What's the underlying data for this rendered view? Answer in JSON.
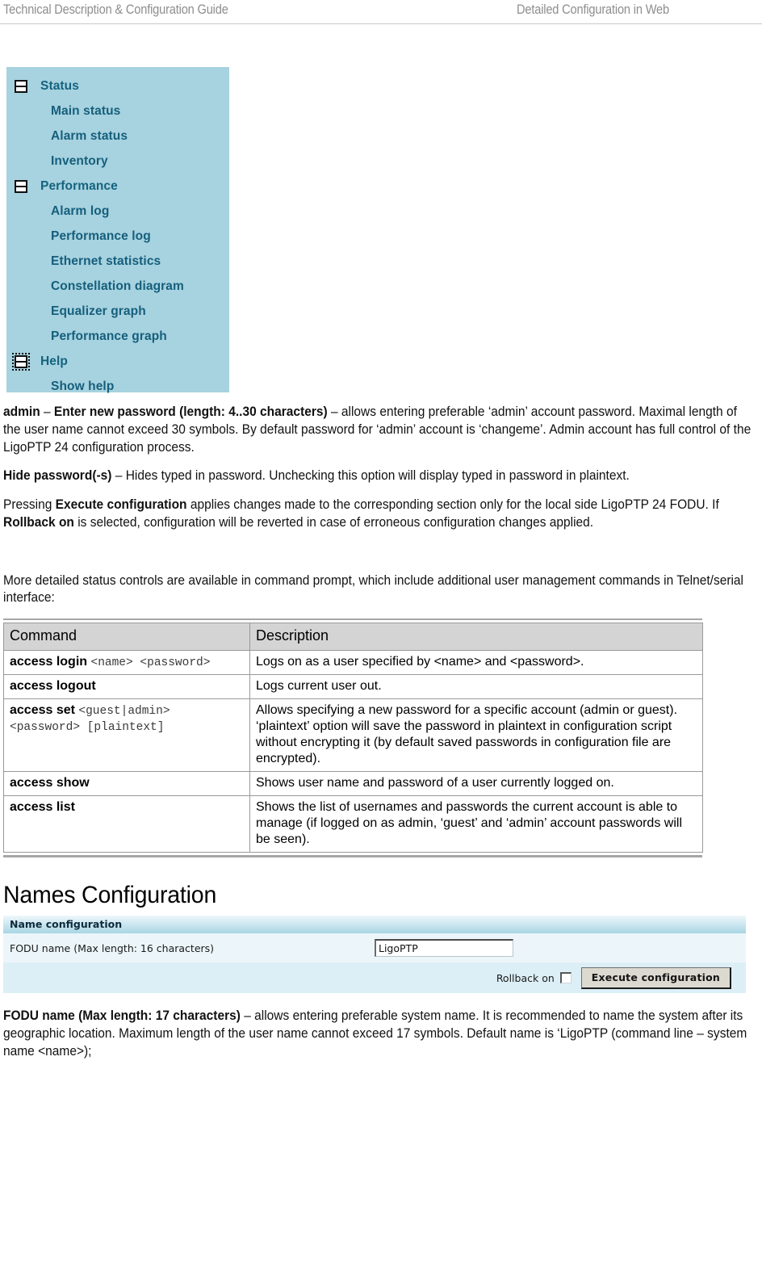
{
  "header": {
    "left": "Technical Description & Configuration Guide",
    "right": "Detailed Configuration in Web"
  },
  "tree": {
    "icon_collapse": "minus-box-icon",
    "items": [
      {
        "label": "Status",
        "level": 0,
        "icon": true,
        "focused": false
      },
      {
        "label": "Main status",
        "level": 1,
        "icon": false,
        "focused": false
      },
      {
        "label": "Alarm status",
        "level": 1,
        "icon": false,
        "focused": false
      },
      {
        "label": "Inventory",
        "level": 1,
        "icon": false,
        "focused": false
      },
      {
        "label": "Performance",
        "level": 0,
        "icon": true,
        "focused": false
      },
      {
        "label": "Alarm log",
        "level": 1,
        "icon": false,
        "focused": false
      },
      {
        "label": "Performance log",
        "level": 1,
        "icon": false,
        "focused": false
      },
      {
        "label": "Ethernet statistics",
        "level": 1,
        "icon": false,
        "focused": false
      },
      {
        "label": "Constellation diagram",
        "level": 1,
        "icon": false,
        "focused": false
      },
      {
        "label": "Equalizer graph",
        "level": 1,
        "icon": false,
        "focused": false
      },
      {
        "label": "Performance graph",
        "level": 1,
        "icon": false,
        "focused": false
      },
      {
        "label": "Help",
        "level": 0,
        "icon": true,
        "focused": true
      },
      {
        "label": "Show help",
        "level": 1,
        "icon": false,
        "focused": false
      }
    ]
  },
  "paragraphs": {
    "admin": {
      "bold1": "admin",
      "sep1": " – ",
      "bold2": "Enter new password (length: 4..30 characters)",
      "rest": " – allows entering preferable ‘admin’ account password. Maximal length of the user name cannot exceed 30 symbols. By default password for ‘admin’ account is ‘changeme’. Admin account has full control of the LigoPTP 24 configuration process."
    },
    "hide_password": {
      "bold1": "Hide password(-s)",
      "rest": " – Hides typed in password. Unchecking this option will display typed in password in plaintext."
    },
    "execute": {
      "pre": "Pressing ",
      "bold1": "Execute configuration",
      "mid": " applies changes made to the corresponding section only for the local side LigoPTP 24 FODU. If ",
      "bold2": "Rollback on",
      "rest": " is selected, configuration will be reverted in case of erroneous configuration changes applied."
    },
    "more_detailed": "More detailed status controls are available in command prompt, which include additional user management commands in Telnet/serial interface:",
    "fodu_name": {
      "bold1": "FODU name (Max length: 17 characters)",
      "rest": " – allows entering preferable system name. It is recommended to name the system after its geographic location. Maximum length of the user name cannot exceed 17 symbols. Default name is ‘LigoPTP (command line – system name <name>);"
    }
  },
  "cmd_table": {
    "headers": [
      "Command",
      "Description"
    ],
    "rows": [
      {
        "cmd_bold": "access login ",
        "cmd_mono": "<name> <password>",
        "desc": "Logs on as a user specified by <name> and <password>."
      },
      {
        "cmd_bold": "access logout",
        "cmd_mono": "",
        "desc": "Logs current user out."
      },
      {
        "cmd_bold": "access set ",
        "cmd_mono": "<guest|admin> <password> [plaintext]",
        "desc": "Allows specifying a new password for a specific account (admin or guest). ‘plaintext’ option will save the password in plaintext in configuration script without encrypting it (by default saved passwords in configuration file are encrypted)."
      },
      {
        "cmd_bold": "access show",
        "cmd_mono": "",
        "desc": "Shows user name and password of a user currently logged on."
      },
      {
        "cmd_bold": "access list",
        "cmd_mono": "",
        "desc": "Shows the list of usernames and passwords the current account is able to manage (if logged on as admin, ‘guest’ and ‘admin’ account passwords will be seen)."
      }
    ]
  },
  "section_heading": "Names Configuration",
  "name_config": {
    "title": "Name configuration",
    "field_label": "FODU name (Max length: 16 characters)",
    "field_value": "LigoPTP",
    "field_placeholder": "",
    "rollback_label": "Rollback on",
    "rollback_checked": false,
    "execute_label": "Execute configuration"
  },
  "colors": {
    "tree_bg": "#a7d2df",
    "tree_text": "#14637f",
    "table_header_bg": "#d4d4d4",
    "widget_title_bg": "#a9d5e4",
    "widget_bg": "#e8f4f9",
    "button_face": "#dcd9d1"
  }
}
